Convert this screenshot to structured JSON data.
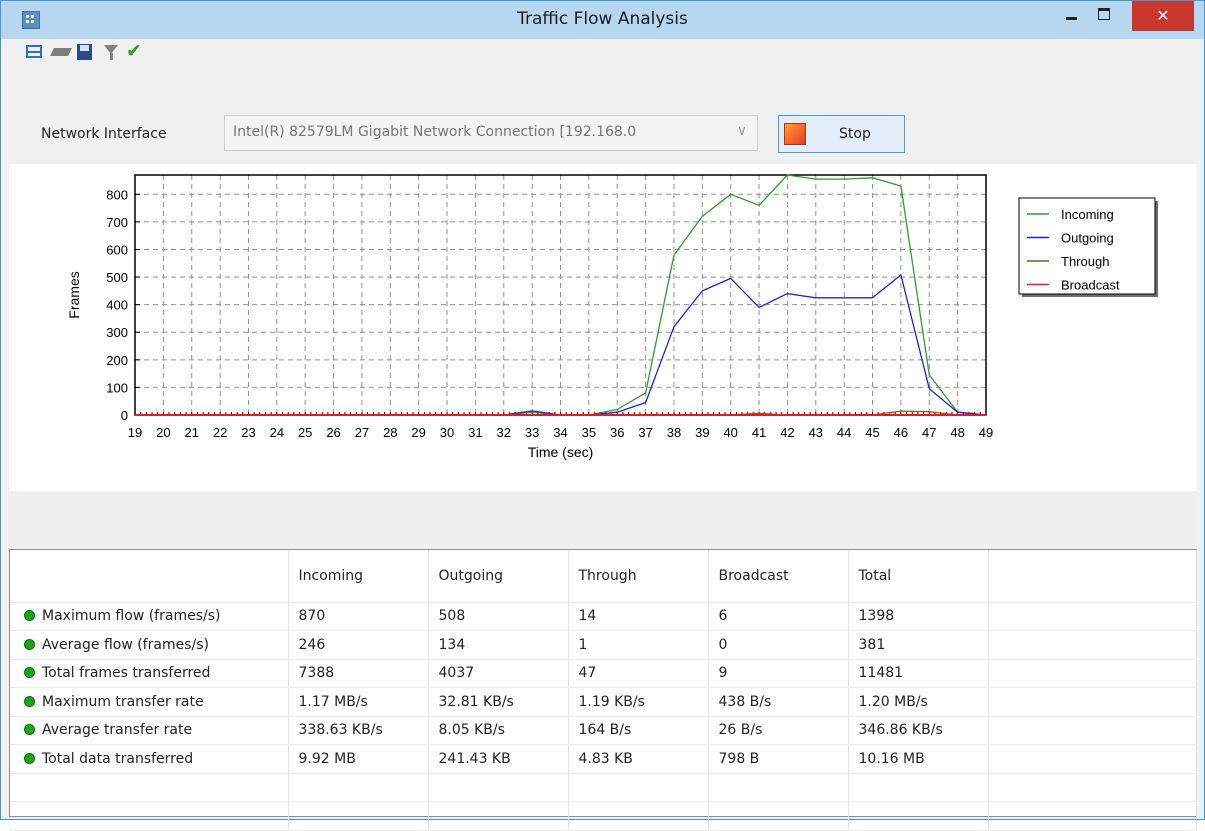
{
  "window": {
    "title": "Traffic Flow Analysis",
    "close_glyph": "✕"
  },
  "toolbar": {
    "check_glyph": "✔"
  },
  "interface": {
    "label": "Network Interface",
    "value": "Intel(R) 82579LM Gigabit Network Connection [192.168.0",
    "chevron": "∨"
  },
  "stop_button": {
    "label": "Stop"
  },
  "colors": {
    "incoming": "#2a9f2a",
    "outgoing": "#1f1fe6",
    "through": "#8b5a1a",
    "broadcast": "#e61c1c"
  },
  "chart_data": {
    "type": "line",
    "xlabel": "Time (sec)",
    "ylabel": "Frames",
    "xlim": [
      19,
      49
    ],
    "ylim": [
      0,
      870
    ],
    "x_ticks": [
      19,
      20,
      21,
      22,
      23,
      24,
      25,
      26,
      27,
      28,
      29,
      30,
      31,
      32,
      33,
      34,
      35,
      36,
      37,
      38,
      39,
      40,
      41,
      42,
      43,
      44,
      45,
      46,
      47,
      48,
      49
    ],
    "y_ticks": [
      0,
      100,
      200,
      300,
      400,
      500,
      600,
      700,
      800
    ],
    "grid": true,
    "legend_position": "right",
    "x": [
      19,
      20,
      21,
      22,
      23,
      24,
      25,
      26,
      27,
      28,
      29,
      30,
      31,
      32,
      33,
      34,
      35,
      36,
      37,
      38,
      39,
      40,
      41,
      42,
      43,
      44,
      45,
      46,
      47,
      48,
      49
    ],
    "series": [
      {
        "name": "Incoming",
        "color": "#2a9f2a",
        "values": [
          0,
          0,
          0,
          0,
          0,
          0,
          0,
          0,
          0,
          0,
          0,
          0,
          0,
          0,
          10,
          0,
          0,
          20,
          80,
          580,
          720,
          800,
          760,
          870,
          855,
          855,
          860,
          830,
          145,
          10,
          0
        ]
      },
      {
        "name": "Outgoing",
        "color": "#1f1fe6",
        "values": [
          0,
          0,
          0,
          0,
          0,
          0,
          0,
          0,
          0,
          0,
          0,
          0,
          0,
          0,
          15,
          0,
          0,
          10,
          45,
          320,
          450,
          495,
          390,
          440,
          425,
          425,
          425,
          508,
          95,
          10,
          0
        ]
      },
      {
        "name": "Through",
        "color": "#8b5a1a",
        "values": [
          0,
          0,
          0,
          0,
          0,
          0,
          0,
          0,
          0,
          0,
          0,
          0,
          0,
          0,
          0,
          0,
          0,
          0,
          0,
          0,
          0,
          0,
          6,
          0,
          0,
          0,
          0,
          14,
          12,
          0,
          0
        ]
      },
      {
        "name": "Broadcast",
        "color": "#e61c1c",
        "values": [
          0,
          0,
          0,
          0,
          0,
          0,
          0,
          0,
          0,
          0,
          0,
          0,
          0,
          0,
          0,
          0,
          0,
          0,
          0,
          0,
          0,
          0,
          0,
          0,
          0,
          0,
          0,
          0,
          0,
          0,
          0
        ]
      }
    ]
  },
  "stats": {
    "headers": [
      "",
      "Incoming",
      "Outgoing",
      "Through",
      "Broadcast",
      "Total"
    ],
    "rows": [
      {
        "label": "Maximum flow (frames/s)",
        "values": [
          "870",
          "508",
          "14",
          "6",
          "1398"
        ]
      },
      {
        "label": "Average flow (frames/s)",
        "values": [
          "246",
          "134",
          "1",
          "0",
          "381"
        ]
      },
      {
        "label": "Total frames transferred",
        "values": [
          "7388",
          "4037",
          "47",
          "9",
          "11481"
        ]
      },
      {
        "label": "Maximum transfer rate",
        "values": [
          "1.17 MB/s",
          "32.81 KB/s",
          "1.19 KB/s",
          "438 B/s",
          "1.20 MB/s"
        ]
      },
      {
        "label": "Average transfer rate",
        "values": [
          "338.63 KB/s",
          "8.05 KB/s",
          "164 B/s",
          "26 B/s",
          "346.86 KB/s"
        ]
      },
      {
        "label": "Total data transferred",
        "values": [
          "9.92 MB",
          "241.43 KB",
          "4.83 KB",
          "798 B",
          "10.16 MB"
        ]
      }
    ]
  }
}
